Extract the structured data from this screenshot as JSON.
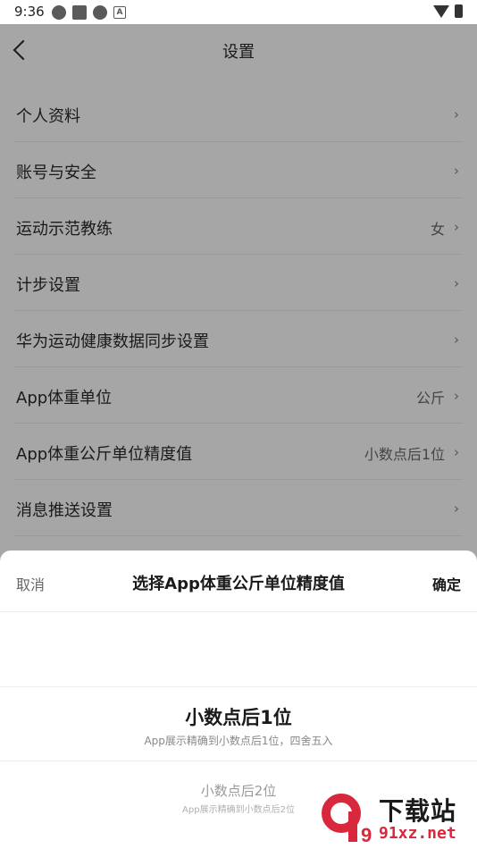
{
  "status_bar": {
    "time": "9:36",
    "left_icons": [
      "app-icon",
      "stop-icon",
      "app-icon",
      "a-icon"
    ],
    "right_icons": [
      "wifi-icon",
      "battery-icon"
    ]
  },
  "navbar": {
    "back_icon": "chevron-left-icon",
    "title": "设置"
  },
  "settings_list": [
    {
      "label": "个人资料",
      "value": ""
    },
    {
      "label": "账号与安全",
      "value": ""
    },
    {
      "label": "运动示范教练",
      "value": "女"
    },
    {
      "label": "计步设置",
      "value": ""
    },
    {
      "label": "华为运动健康数据同步设置",
      "value": ""
    },
    {
      "label": "App体重单位",
      "value": "公斤"
    },
    {
      "label": "App体重公斤单位精度值",
      "value": "小数点后1位"
    },
    {
      "label": "消息推送设置",
      "value": ""
    }
  ],
  "chevron": "›",
  "sheet": {
    "cancel_label": "取消",
    "title": "选择App体重公斤单位精度值",
    "confirm_label": "确定",
    "options": [
      {
        "main": "小数点后1位",
        "sub": "App展示精确到小数点后1位，四舍五入"
      },
      {
        "main": "小数点后2位",
        "sub": "App展示精确到小数点后2位"
      }
    ]
  },
  "watermark": {
    "logo_text": "9",
    "top_text": "下载站",
    "bottom_text": "91xz.net"
  },
  "colors": {
    "overlay_background": "#a6a6a6",
    "sheet_background": "#ffffff",
    "watermark_red": "#d9283b"
  }
}
